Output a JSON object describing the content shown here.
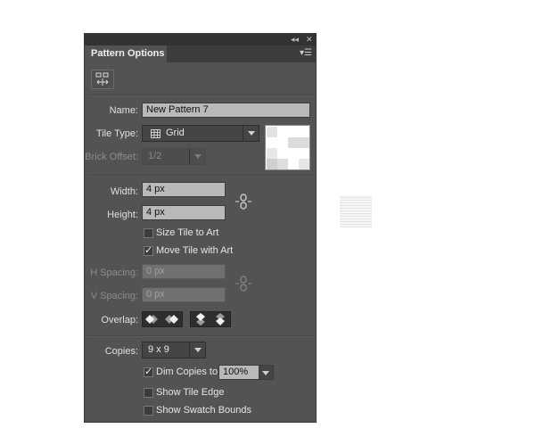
{
  "panel": {
    "tab_title": "Pattern Options",
    "collapse_glyph": "◂◂",
    "close_glyph": "✕",
    "menu_glyph": "▾☰"
  },
  "name": {
    "label": "Name:",
    "value": "New Pattern 7"
  },
  "tile_type": {
    "label": "Tile Type:",
    "value": "Grid",
    "icon": "grid-icon"
  },
  "brick_offset": {
    "label": "Brick Offset:",
    "value": "1/2"
  },
  "width": {
    "label": "Width:",
    "value": "4 px"
  },
  "height": {
    "label": "Height:",
    "value": "4 px"
  },
  "size_tile_to_art": {
    "label": "Size Tile to Art",
    "checked": false
  },
  "move_tile_with_art": {
    "label": "Move Tile with Art",
    "checked": true
  },
  "h_spacing": {
    "label": "H Spacing:",
    "value": "0 px"
  },
  "v_spacing": {
    "label": "V Spacing:",
    "value": "0 px"
  },
  "overlap": {
    "label": "Overlap:"
  },
  "copies": {
    "label": "Copies:",
    "value": "9 x 9"
  },
  "dim_copies": {
    "label": "Dim Copies to:",
    "checked": true,
    "value": "100%"
  },
  "show_tile_edge": {
    "label": "Show Tile Edge",
    "checked": false
  },
  "show_swatch_bounds": {
    "label": "Show Swatch Bounds",
    "checked": false
  },
  "colors": {
    "panel_bg": "#535353",
    "titlebar_bg": "#323232",
    "field_bg": "#b9b9b9"
  }
}
